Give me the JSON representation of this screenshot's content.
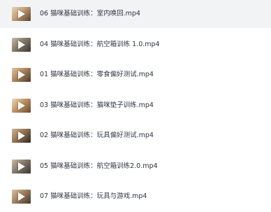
{
  "files": [
    {
      "name": "06 猫咪基础训练：室内唤回.mp4",
      "selected": true,
      "thumb_colors": [
        "#c9a27a",
        "#5a4330",
        "#e6d3b8"
      ]
    },
    {
      "name": "04 猫咪基础训练：航空箱训练 1.0.mp4",
      "selected": false,
      "thumb_colors": [
        "#8c8170",
        "#3c362f",
        "#c8bca8"
      ]
    },
    {
      "name": "01 猫咪基础训练：零食偏好测试.mp4",
      "selected": false,
      "thumb_colors": [
        "#b58b62",
        "#4b3a2a",
        "#dbc6a8"
      ]
    },
    {
      "name": "03 猫咪基础训练：猫咪垫子训练.mp4",
      "selected": false,
      "thumb_colors": [
        "#c79a6c",
        "#6a4a2e",
        "#ead8bf"
      ]
    },
    {
      "name": "02 猫咪基础训练：玩具偏好测试.mp4",
      "selected": false,
      "thumb_colors": [
        "#9c7a58",
        "#2f2a26",
        "#cbb597"
      ]
    },
    {
      "name": "05 猫咪基础训练：航空箱训练2.0.mp4",
      "selected": false,
      "thumb_colors": [
        "#8d8070",
        "#3a342e",
        "#c9bca9"
      ]
    },
    {
      "name": "07 猫咪基础训练：玩具与游戏.mp4",
      "selected": false,
      "thumb_colors": [
        "#a88864",
        "#45372a",
        "#d8c4a6"
      ]
    }
  ]
}
